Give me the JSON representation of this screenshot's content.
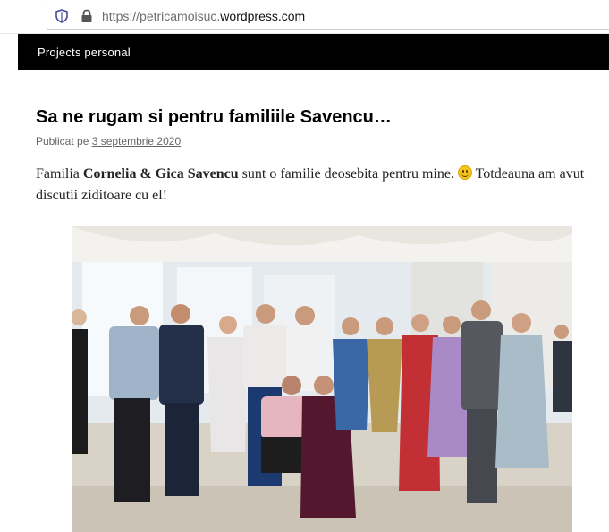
{
  "browser": {
    "url_protocol": "https://",
    "url_subdomain": "petricamoisuc.",
    "url_domain": "wordpress.com",
    "icons": [
      "shield-icon",
      "lock-icon"
    ]
  },
  "nav": {
    "item_label": "Projects personal"
  },
  "post": {
    "title": "Sa ne rugam si pentru familiile Savencu…",
    "meta_prefix": "Publicat pe",
    "date": "3 septembrie 2020",
    "para_1": "Familia ",
    "name_1": "Cornelia",
    "para_amp": " & ",
    "name_2": "Gica Savencu",
    "para_2": " sunt o familie deosebita pentru mine. ",
    "emoji": "smiley-icon",
    "para_3": " Totdeauna am avut discutii ziditoare cu el!"
  },
  "colors": {
    "navbar_bg": "#000000",
    "navbar_text": "#ffffff",
    "link": "#666666"
  }
}
